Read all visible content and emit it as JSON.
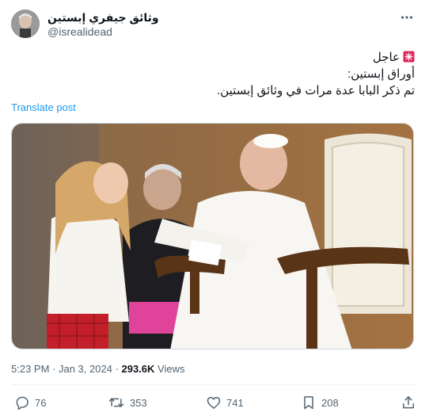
{
  "author": {
    "display_name": "وثائق جيفري إبستين",
    "handle": "@isrealidead",
    "avatar_icon": "avatar-photo"
  },
  "tweet": {
    "lines": [
      "عاجل",
      "أوراق إبستين:",
      "تم ذكر البابا عدة مرات في وثائق إبستين."
    ],
    "alert_icon": "rotating-light-emoji"
  },
  "translate_label": "Translate post",
  "meta": {
    "timestamp": "5:23 PM · Jan 3, 2024",
    "separator": " · ",
    "views_count": "293.6K",
    "views_label": " Views"
  },
  "actions": {
    "replies": "76",
    "reposts": "353",
    "likes": "741",
    "bookmarks": "208"
  },
  "colors": {
    "link": "#1d9bf0",
    "text": "#0f1419",
    "secondary": "#536471",
    "border": "#cfd9de"
  }
}
